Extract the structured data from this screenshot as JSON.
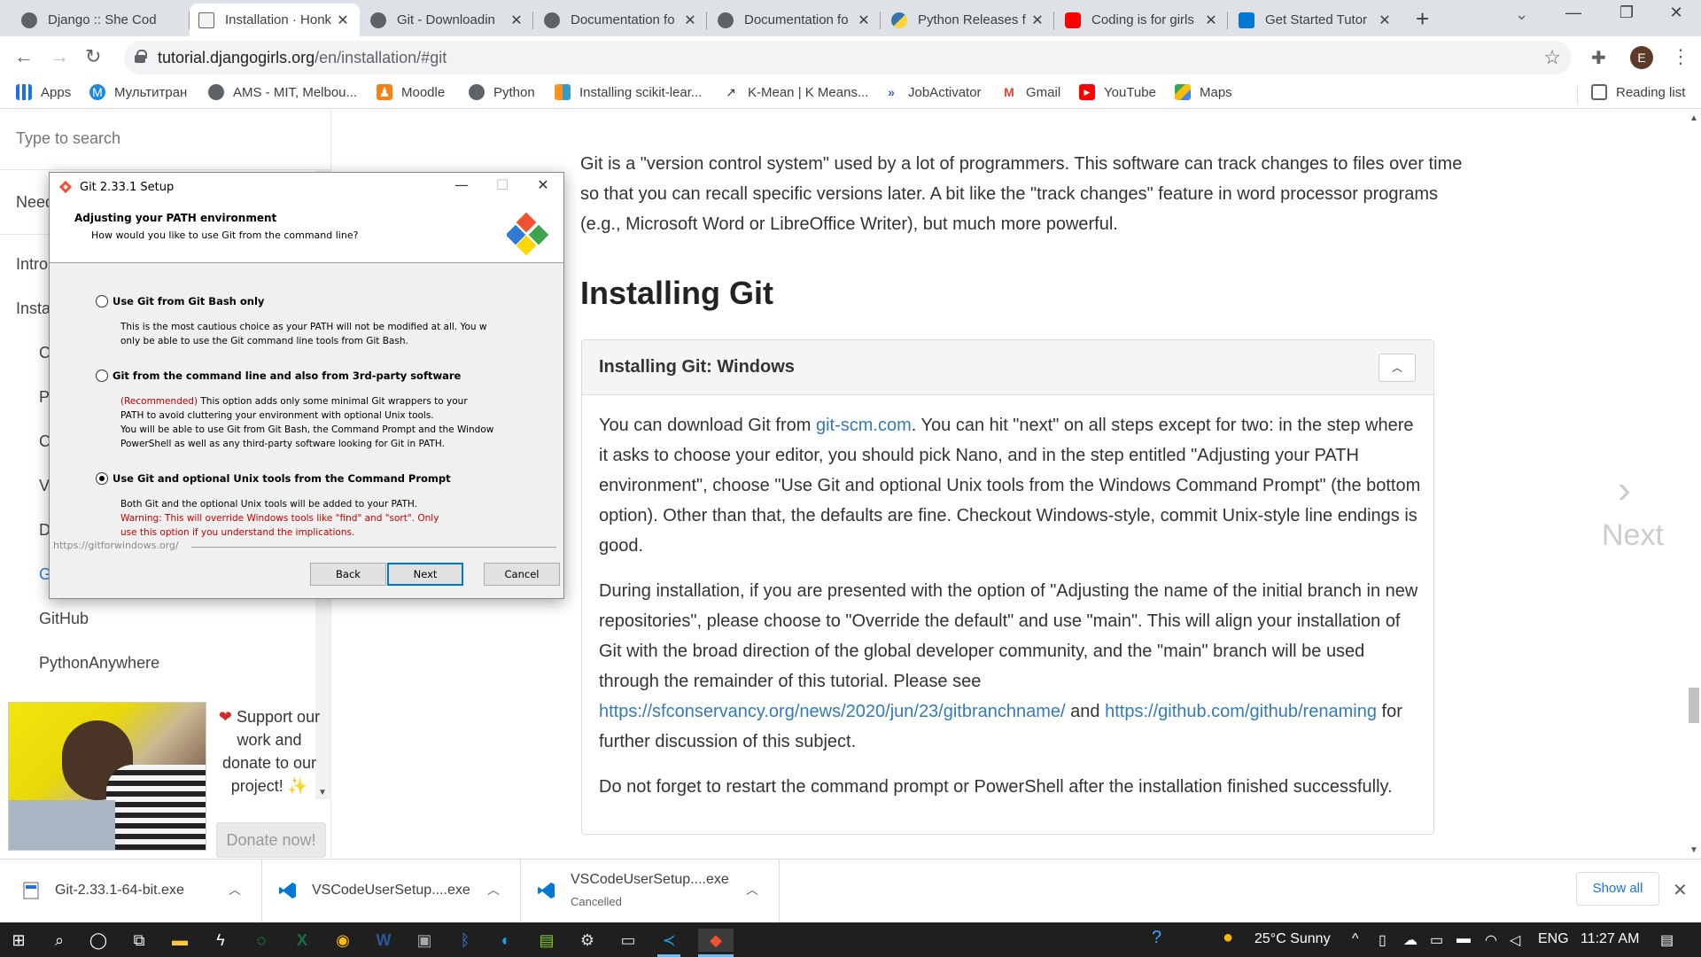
{
  "browser": {
    "tabs": [
      {
        "title": "Django :: She Cod",
        "favicon": "globe-icon"
      },
      {
        "title": "Installation · Honk",
        "favicon": "book-icon"
      },
      {
        "title": "Git - Downloadin",
        "favicon": "globe-icon"
      },
      {
        "title": "Documentation fo",
        "favicon": "globe-icon"
      },
      {
        "title": "Documentation fo",
        "favicon": "globe-icon"
      },
      {
        "title": "Python Releases f",
        "favicon": "python-icon"
      },
      {
        "title": "Coding is for girls",
        "favicon": "youtube-icon"
      },
      {
        "title": "Get Started Tutor",
        "favicon": "vscode-icon"
      }
    ],
    "url_host": "tutorial.djangogirls.org",
    "url_path": "/en/installation/#git",
    "avatar_letter": "E",
    "bookmarks": [
      {
        "label": "Apps",
        "icon": "apps-grid-icon"
      },
      {
        "label": "Мультитран",
        "icon": "multitran-icon"
      },
      {
        "label": "AMS - MIT, Melbou...",
        "icon": "globe-icon"
      },
      {
        "label": "Moodle",
        "icon": "moodle-icon"
      },
      {
        "label": "Python",
        "icon": "globe-icon"
      },
      {
        "label": "Installing scikit-lear...",
        "icon": "chart-icon"
      },
      {
        "label": "K-Mean | K Means...",
        "icon": "kmeans-icon"
      },
      {
        "label": "JobActivator",
        "icon": "jobactivator-icon"
      },
      {
        "label": "Gmail",
        "icon": "gmail-icon"
      },
      {
        "label": "YouTube",
        "icon": "youtube-icon"
      },
      {
        "label": "Maps",
        "icon": "maps-icon"
      }
    ],
    "reading_list": "Reading list"
  },
  "sidebar": {
    "search_placeholder": "Type to search",
    "items": [
      {
        "label": "Need"
      },
      {
        "label": "Intro"
      },
      {
        "label": "Insta"
      },
      {
        "label": "C"
      },
      {
        "label": "P"
      },
      {
        "label": "C"
      },
      {
        "label": "V"
      },
      {
        "label": "D"
      },
      {
        "label": "G"
      },
      {
        "label": "GitHub"
      },
      {
        "label": "PythonAnywhere"
      }
    ],
    "donate_text": "Support our work and donate to our project!",
    "donate_button": "Donate now!"
  },
  "article": {
    "intro": "Git is a \"version control system\" used by a lot of programmers. This software can track changes to files over time so that you can recall specific versions later. A bit like the \"track changes\" feature in word processor programs (e.g., Microsoft Word or LibreOffice Writer), but much more powerful.",
    "heading": "Installing Git",
    "panel_title": "Installing Git: Windows",
    "p1_before": "You can download Git from ",
    "p1_link": "git-scm.com",
    "p1_after": ". You can hit \"next\" on all steps except for two: in the step where it asks to choose your editor, you should pick Nano, and in the step entitled \"Adjusting your PATH environment\", choose \"Use Git and optional Unix tools from the Windows Command Prompt\" (the bottom option). Other than that, the defaults are fine. Checkout Windows-style, commit Unix-style line endings is good.",
    "p2_before": "During installation, if you are presented with the option of \"Adjusting the name of the initial branch in new repositories\", please choose to \"Override the default\" and use \"main\". This will align your installation of Git with the broad direction of the global developer community, and the \"main\" branch will be used through the remainder of this tutorial. Please see ",
    "p2_link1": "https://sfconservancy.org/news/2020/jun/23/gitbranchname/",
    "p2_and": " and ",
    "p2_link2": "https://github.com/github/renaming",
    "p2_after": " for further discussion of this subject.",
    "p3": "Do not forget to restart the command prompt or PowerShell after the installation finished successfully.",
    "next_label": "Next"
  },
  "dialog": {
    "title": "Git 2.33.1 Setup",
    "header": "Adjusting your PATH environment",
    "subheader": "How would you like to use Git from the command line?",
    "options": [
      {
        "label": "Use Git from Git Bash only",
        "selected": false,
        "desc_lines": [
          "This is the most cautious choice as your PATH will not be modified at all. You w",
          "only be able to use the Git command line tools from Git Bash."
        ]
      },
      {
        "label": "Git from the command line and also from 3rd-party software",
        "selected": false,
        "recommended": "(Recommended)",
        "desc_line1_rest": " This option adds only some minimal Git wrappers to your",
        "desc_lines": [
          "PATH to avoid cluttering your environment with optional Unix tools.",
          "You will be able to use Git from Git Bash, the Command Prompt and the Window",
          "PowerShell as well as any third-party software looking for Git in PATH."
        ]
      },
      {
        "label": "Use Git and optional Unix tools from the Command Prompt",
        "selected": true,
        "desc_lines": [
          "Both Git and the optional Unix tools will be added to your PATH."
        ],
        "warning_lines": [
          "Warning: This will override Windows tools like \"find\" and \"sort\". Only",
          "use this option if you understand the implications."
        ]
      }
    ],
    "footer_url": "https://gitforwindows.org/",
    "back": "Back",
    "next": "Next",
    "cancel": "Cancel"
  },
  "downloads": [
    {
      "name": "Git-2.33.1-64-bit.exe",
      "status": "",
      "icon": "exe-file-icon"
    },
    {
      "name": "VSCodeUserSetup....exe",
      "status": "",
      "icon": "vscode-icon"
    },
    {
      "name": "VSCodeUserSetup....exe",
      "status": "Cancelled",
      "icon": "vscode-icon"
    }
  ],
  "show_all": "Show all",
  "taskbar": {
    "weather": "25°C  Sunny",
    "language": "ENG",
    "time": "11:27 AM"
  },
  "colors": {
    "accent_link": "#337ab7",
    "warning_red": "#c00000",
    "chrome_tabstrip": "#dee1e6",
    "taskbar": "#1f1f1f"
  }
}
